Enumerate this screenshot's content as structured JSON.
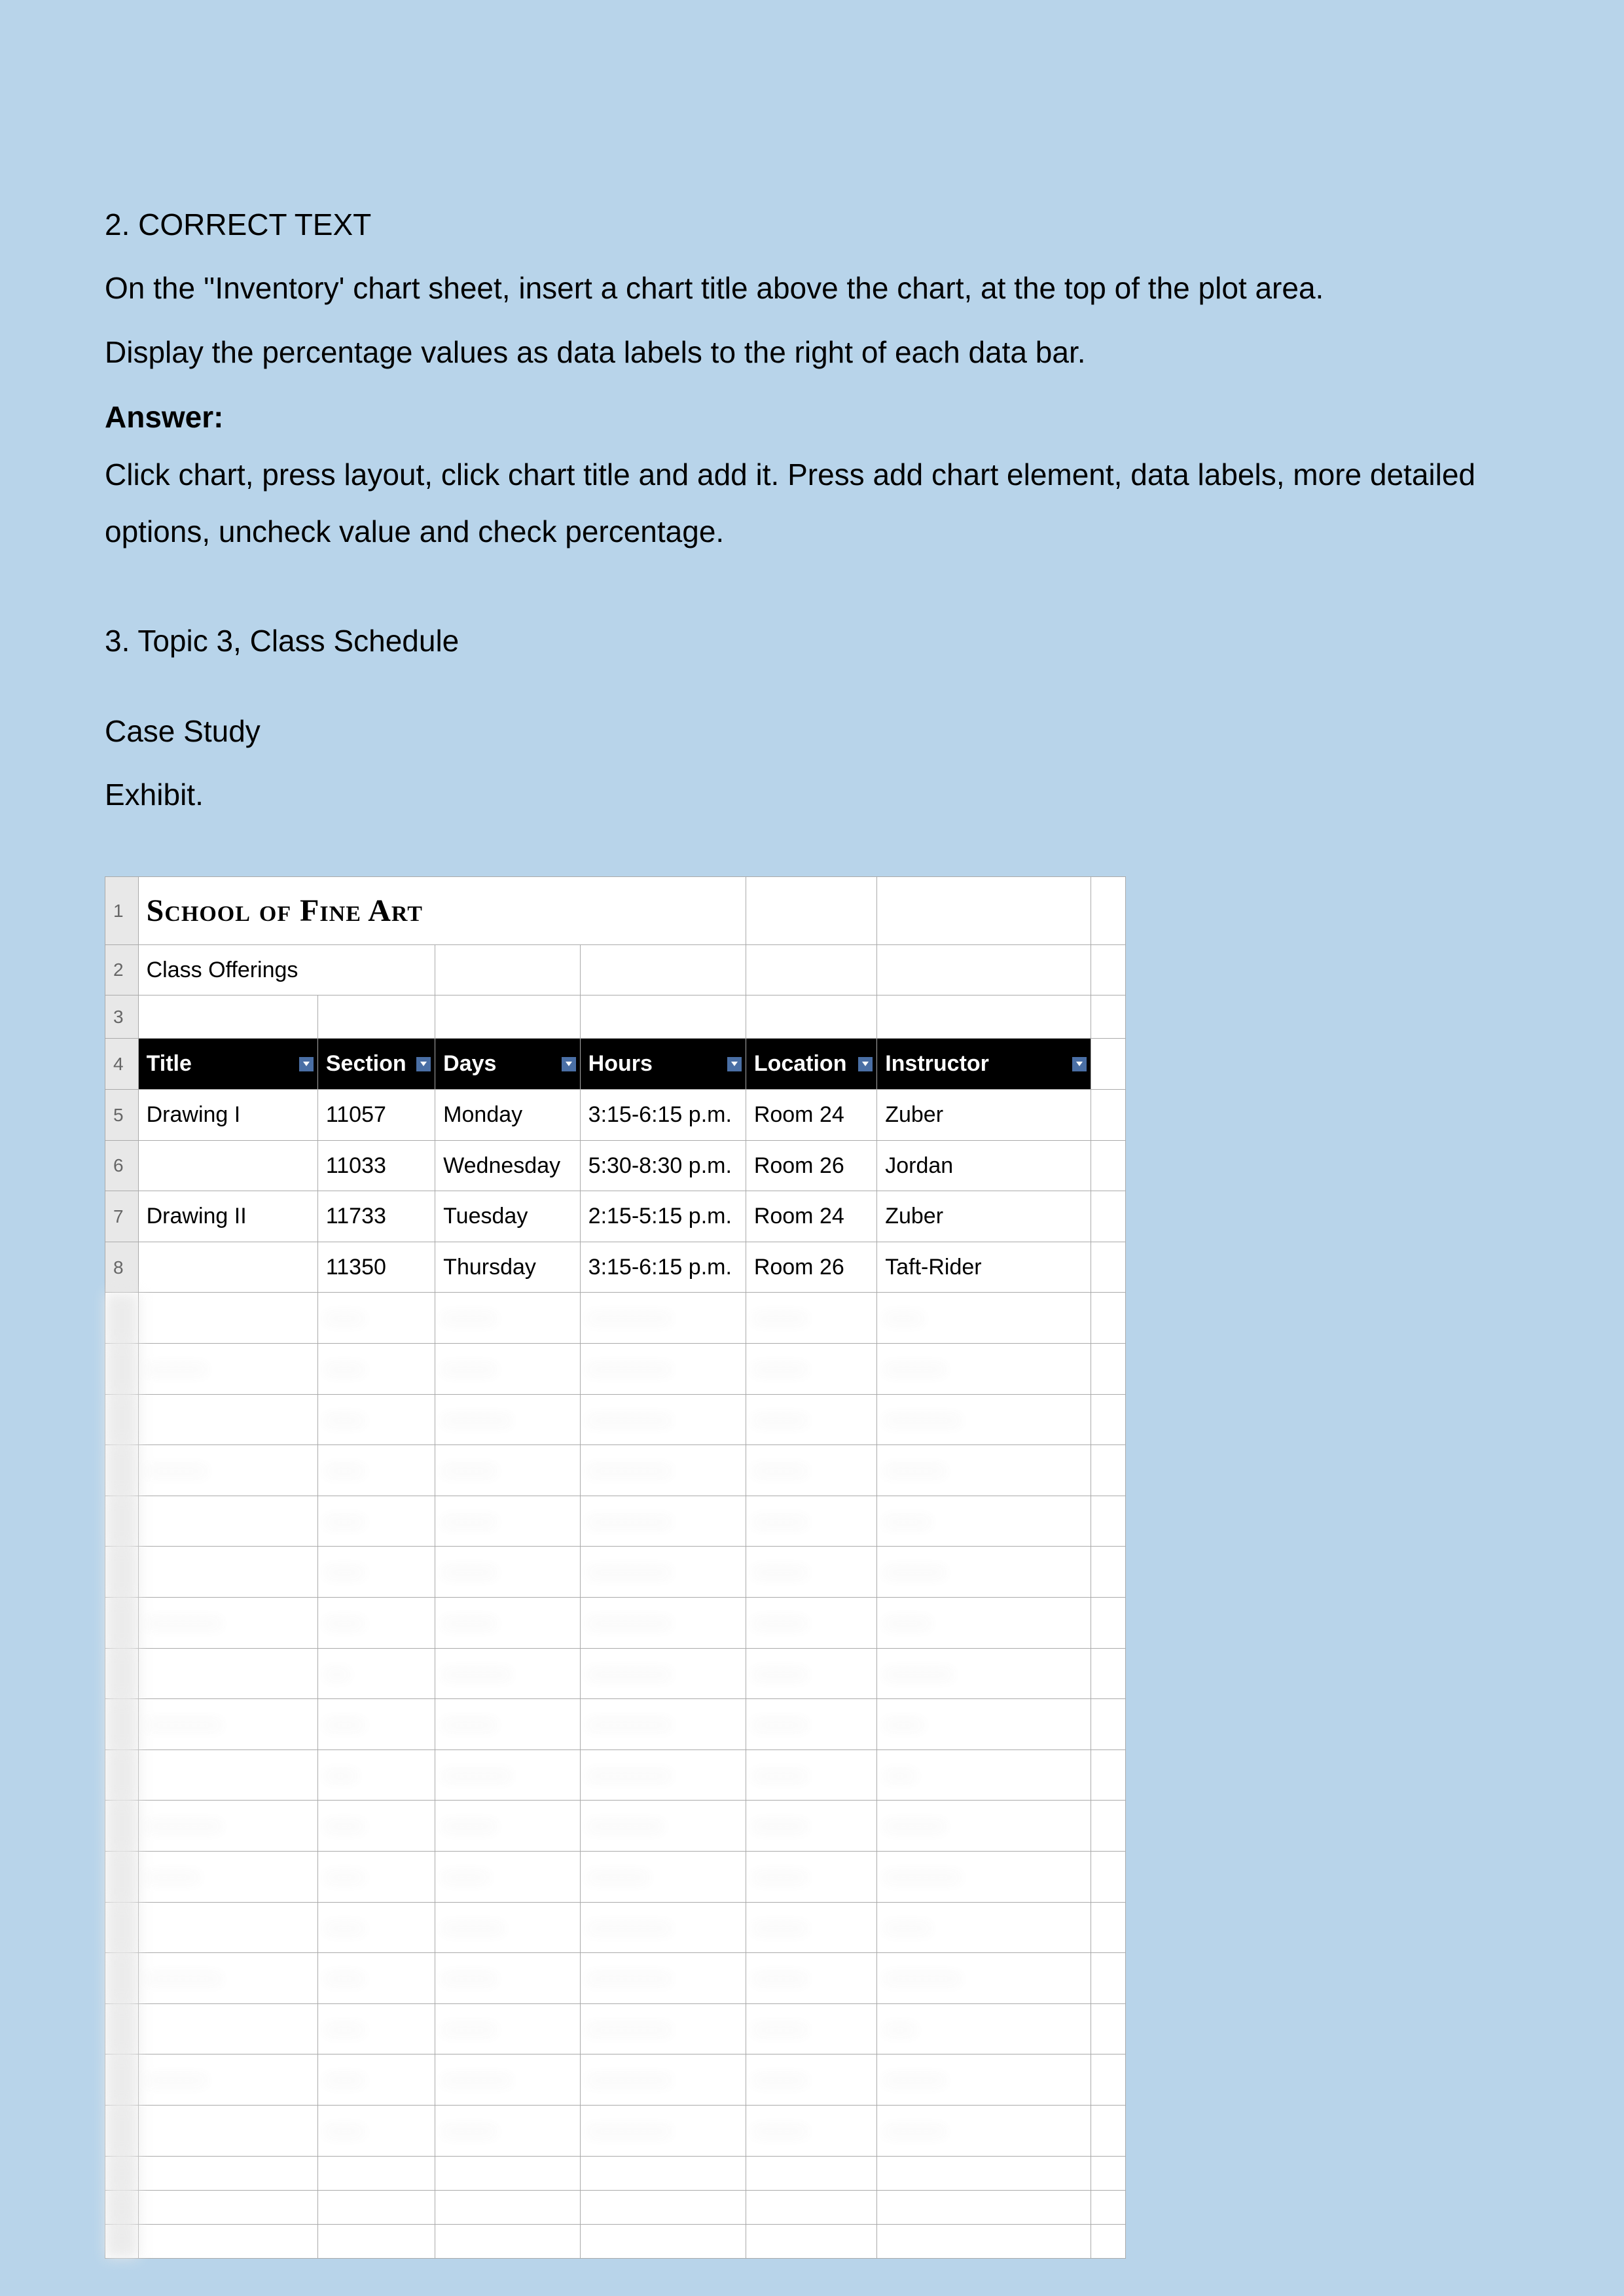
{
  "question2": {
    "heading": "2. CORRECT TEXT",
    "para1": "On the ''Inventory' chart sheet, insert a chart title above the chart, at the top of the plot area.",
    "para2": "Display the percentage values as data labels to the right of each data bar.",
    "answer_label": "Answer:",
    "answer_text": "Click chart, press layout, click chart title and add it. Press add chart element, data labels, more detailed options, uncheck value and check percentage."
  },
  "question3": {
    "heading": "3. Topic 3, Class Schedule",
    "case_study": "Case Study",
    "exhibit": "Exhibit."
  },
  "sheet": {
    "title": "School of Fine Art",
    "subtitle": "Class Offerings",
    "rownums": [
      "1",
      "2",
      "3",
      "4",
      "5",
      "6",
      "7",
      "8"
    ],
    "headers": {
      "title": "Title",
      "section": "Section",
      "days": "Days",
      "hours": "Hours",
      "location": "Location",
      "instructor": "Instructor"
    },
    "rows": [
      {
        "title": "Drawing I",
        "section": "11057",
        "days": "Monday",
        "hours": "3:15-6:15 p.m.",
        "location": "Room 24",
        "instructor": "Zuber"
      },
      {
        "title": "",
        "section": "11033",
        "days": "Wednesday",
        "hours": "5:30-8:30 p.m.",
        "location": "Room 26",
        "instructor": "Jordan"
      },
      {
        "title": "Drawing II",
        "section": "11733",
        "days": "Tuesday",
        "hours": "2:15-5:15 p.m.",
        "location": "Room 24",
        "instructor": "Zuber"
      },
      {
        "title": "",
        "section": "11350",
        "days": "Thursday",
        "hours": "3:15-6:15 p.m.",
        "location": "Room 26",
        "instructor": "Taft-Rider"
      }
    ]
  }
}
